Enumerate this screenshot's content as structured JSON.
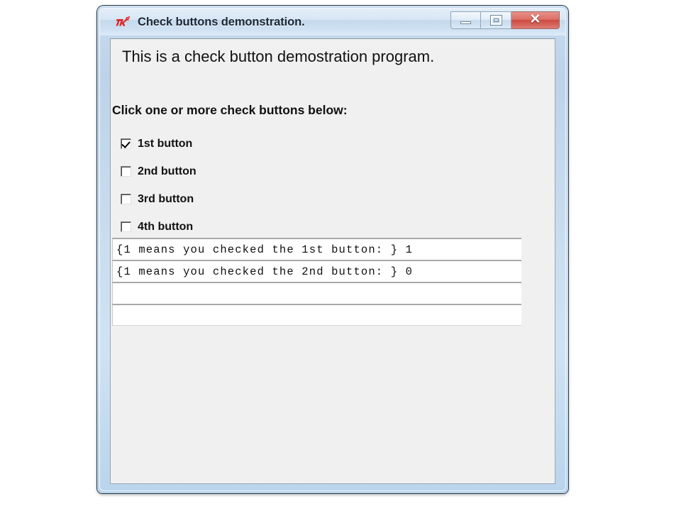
{
  "window": {
    "title": "Check buttons demonstration.",
    "app_icon": "tk-feather-icon",
    "controls": {
      "minimize_label": "Minimize",
      "restore_label": "Restore",
      "close_label": "✕"
    },
    "colors": {
      "frame_glass": "#c6dbee",
      "client_background": "#f0f0f0",
      "close_button": "#cc4a42",
      "logo_red": "#e02020",
      "entry_background": "#ffffff"
    }
  },
  "content": {
    "heading": "This is a check button demostration program.",
    "prompt": "Click one or more check buttons below:",
    "checkbuttons": [
      {
        "label": "1st button",
        "checked": true
      },
      {
        "label": "2nd button",
        "checked": false
      },
      {
        "label": "3rd button",
        "checked": false
      },
      {
        "label": "4th button",
        "checked": false
      }
    ],
    "entries": [
      {
        "value": "{1 means you checked the 1st button: } 1"
      },
      {
        "value": "{1 means you checked the 2nd button: } 0"
      },
      {
        "value": ""
      },
      {
        "value": ""
      }
    ]
  }
}
